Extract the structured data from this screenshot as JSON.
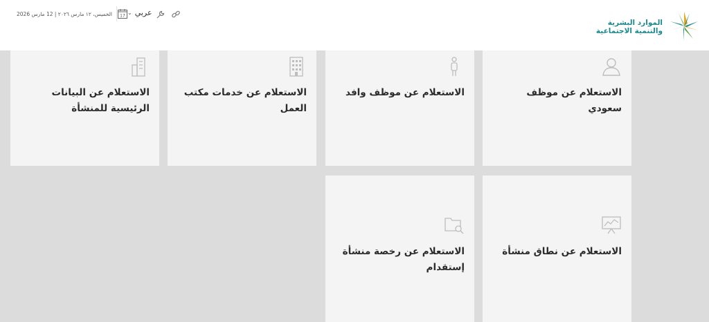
{
  "header": {
    "logo": {
      "line1": "الموارد البشرية",
      "line2": "والتنمية الاجتماعية"
    },
    "date": {
      "text": "الخميس، ١٢ مارس ٢٠٢٦ | 12 مارس 2026",
      "calendar_day": "17"
    },
    "language": {
      "label": "عربي"
    },
    "icons": {
      "wrench": "wrench-icon",
      "link": "link-icon",
      "calendar": "calendar-icon"
    }
  },
  "cards": [
    {
      "title": "الاستعلام عن موظف سعودي",
      "icon": "person-icon"
    },
    {
      "title": "الاستعلام عن موظف وافد",
      "icon": "worker-icon"
    },
    {
      "title": "الاستعلام عن خدمات مكتب العمل",
      "icon": "building-icon"
    },
    {
      "title": "الاستعلام عن البيانات الرئيسية للمنشأة",
      "icon": "buildings-icon"
    },
    {
      "title": "الاستعلام عن نطاق منشأة",
      "icon": "chart-board-icon"
    },
    {
      "title": "الاستعلام عن رخصة منشأة إستقدام",
      "icon": "folder-search-icon"
    }
  ],
  "colors": {
    "brand_teal": "#1c8a8d",
    "brand_gold": "#e8a825",
    "brand_green": "#5aa545"
  }
}
